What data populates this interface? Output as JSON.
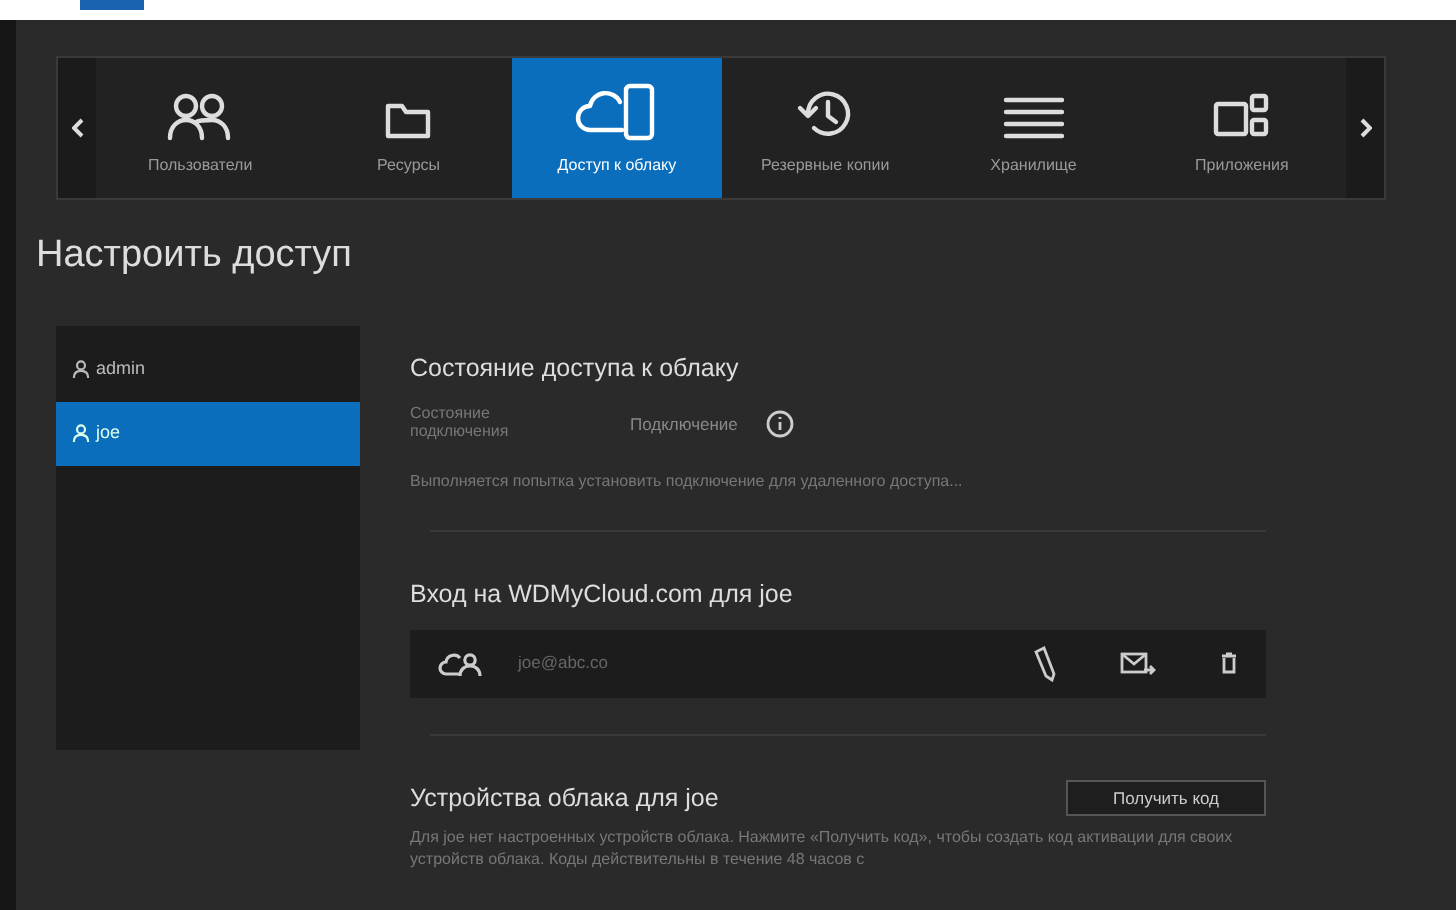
{
  "nav": {
    "tabs": [
      {
        "label": "Пользователи",
        "kind": "users",
        "selected": false
      },
      {
        "label": "Ресурсы",
        "kind": "folder",
        "selected": false
      },
      {
        "label": "Доступ к облаку",
        "kind": "cloud",
        "selected": true
      },
      {
        "label": "Резервные копии",
        "kind": "history",
        "selected": false
      },
      {
        "label": "Хранилище",
        "kind": "storage",
        "selected": false
      },
      {
        "label": "Приложения",
        "kind": "apps",
        "selected": false
      }
    ]
  },
  "page_title": "Настроить доступ",
  "users": [
    {
      "name": "admin",
      "selected": false
    },
    {
      "name": "joe",
      "selected": true
    }
  ],
  "cloud_status": {
    "heading": "Состояние доступа к облаку",
    "label": "Состояние подключения",
    "value": "Подключение",
    "message": "Выполняется попытка установить подключение для удаленного доступа..."
  },
  "login": {
    "heading": "Вход на WDMyCloud.com для joe",
    "email": "joe@abc.co"
  },
  "devices": {
    "heading": "Устройства облака для joe",
    "button": "Получить код",
    "text": "Для joe нет настроенных устройств облака. Нажмите «Получить код», чтобы создать код активации для своих устройств облака. Коды действительны в течение 48 часов с"
  }
}
